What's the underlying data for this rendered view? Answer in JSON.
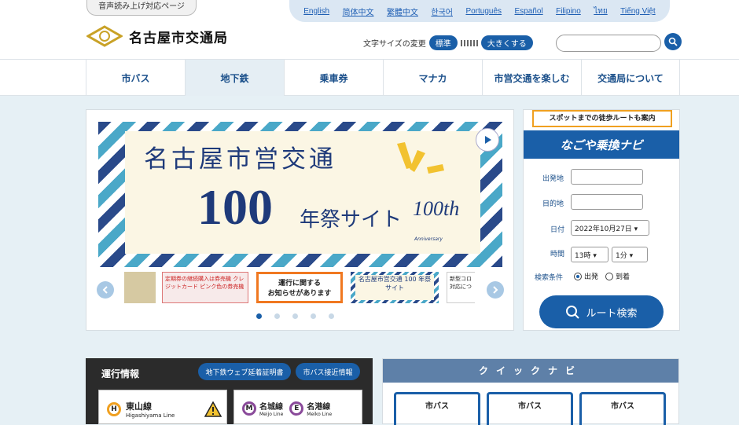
{
  "header": {
    "voice_button": "音声読み上げ対応ページ",
    "languages": [
      "English",
      "简体中文",
      "繁體中文",
      "한국어",
      "Português",
      "Español",
      "Filipino",
      "ไทย",
      "Tiếng Việt"
    ],
    "logo_text": "名古屋市交通局",
    "font_size_label": "文字サイズの変更",
    "font_standard": "標準",
    "font_large": "大きくする"
  },
  "nav": {
    "items": [
      "市バス",
      "地下鉄",
      "乗車券",
      "マナカ",
      "市営交通を楽しむ",
      "交通局について"
    ],
    "active_index": 1
  },
  "slider": {
    "title": "名古屋市営交通",
    "number": "100",
    "subtitle": "年祭サイト",
    "anniversary": "100th",
    "anniversary_sub": "Anniversary",
    "thumb2_text": "定期券の継続購入は券売機 クレジットカード ピンク色の券売機",
    "thumb3_text": "運行に関する\nお知らせがあります",
    "thumb4_text": "名古屋市営交通 100 年祭サイト",
    "thumb5_text": "新型コロ 対応につ",
    "slide_count": 5,
    "active_slide": 0
  },
  "route_search": {
    "callout": "スポットまでの徒歩ルートも案内",
    "logo": "なごや乗換ナビ",
    "from_label": "出発地",
    "to_label": "目的地",
    "date_label": "日付",
    "date_value": "2022年10月27日",
    "time_label": "時間",
    "hour_value": "13時",
    "minute_value": "1分",
    "condition_label": "検索条件",
    "depart_option": "出発",
    "arrive_option": "到着",
    "button": "ルート検索"
  },
  "operations": {
    "title": "運行情報",
    "btn_cert": "地下鉄ウェブ延着証明書",
    "btn_bus": "市バス接近情報",
    "lines": [
      {
        "mark": "H",
        "name": "東山線",
        "roman": "Higashiyama Line",
        "color": "#f0a020"
      },
      {
        "mark": "M",
        "name": "名城線",
        "roman": "Meijo Line",
        "color": "#8a4a9a"
      },
      {
        "mark": "E",
        "name": "名港線",
        "roman": "Meiko Line",
        "color": "#8a4a9a"
      }
    ]
  },
  "quick_nav": {
    "title": "クイックナビ",
    "cards": [
      "市バス",
      "市バス",
      "市バス"
    ]
  },
  "colors": {
    "primary": "#1a5fa8",
    "accent": "#f0a020"
  }
}
